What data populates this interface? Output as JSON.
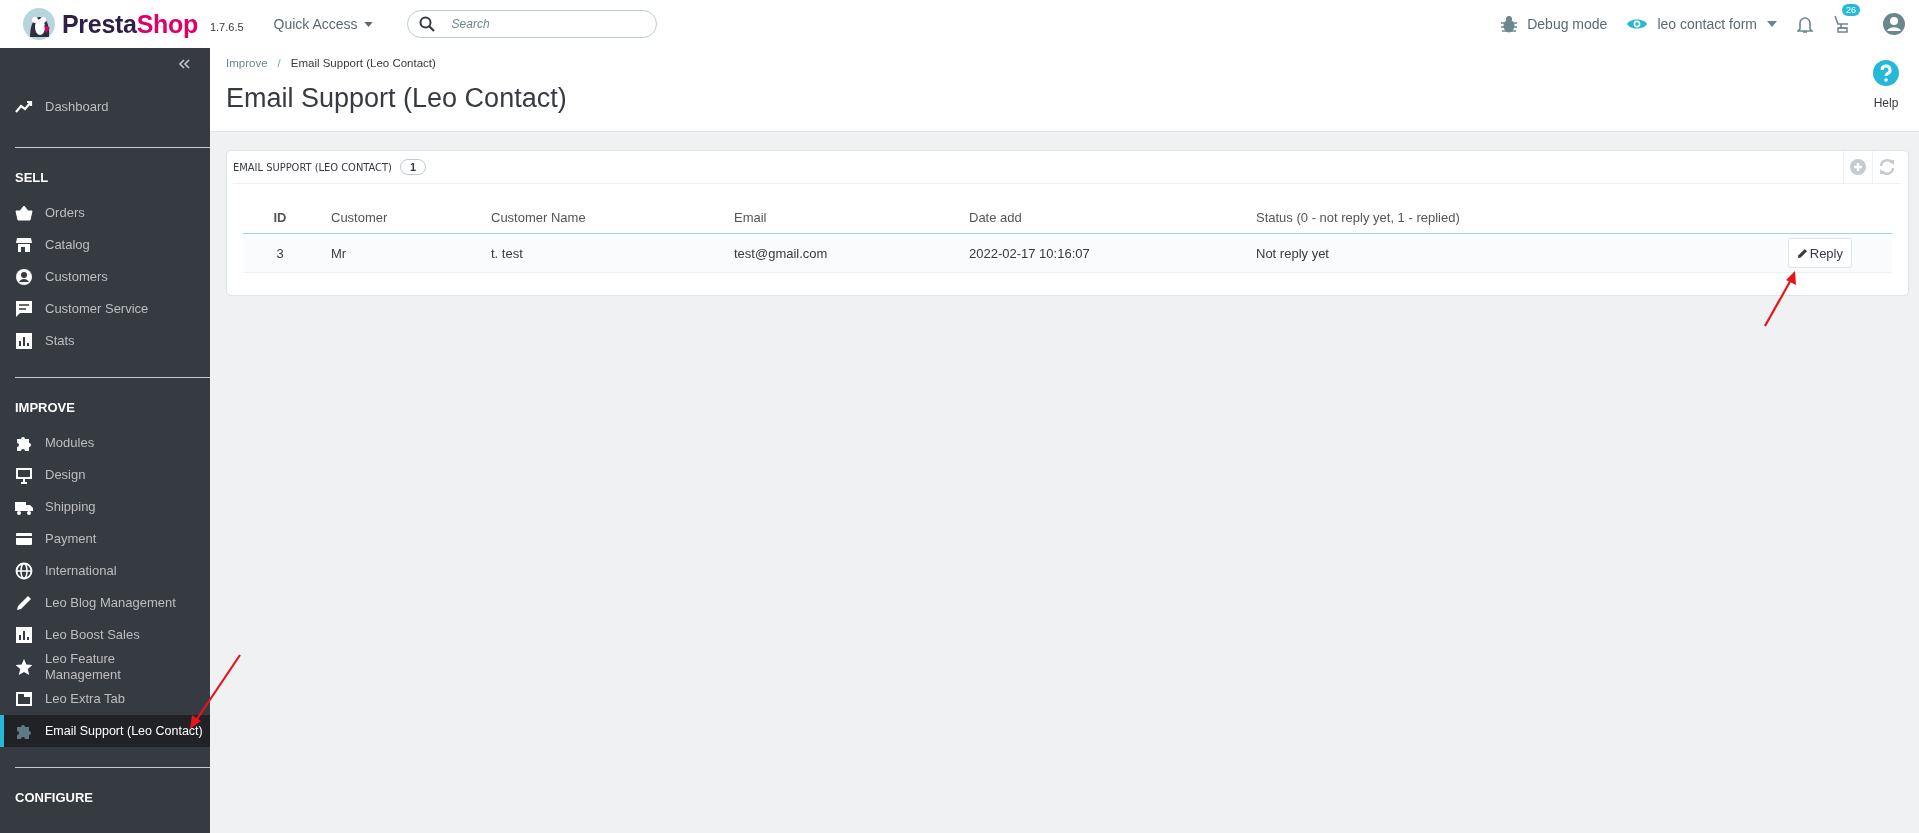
{
  "topbar": {
    "logo": [
      "Presta",
      "Shop"
    ],
    "version": "1.7.6.5",
    "quick_access": "Quick Access",
    "search": {
      "placeholder": "Search"
    },
    "debug": "Debug mode",
    "shop": "leo contact form",
    "orders_badge": "26"
  },
  "sidebar": {
    "sections": [
      {
        "items": [
          {
            "label": "Dashboard",
            "selected": false
          }
        ]
      },
      {
        "heading": "SELL",
        "items": [
          {
            "label": "Orders",
            "selected": false
          },
          {
            "label": "Catalog",
            "selected": false
          },
          {
            "label": "Customers",
            "selected": false
          },
          {
            "label": "Customer Service",
            "selected": false
          },
          {
            "label": "Stats",
            "selected": false
          }
        ]
      },
      {
        "heading": "IMPROVE",
        "items": [
          {
            "label": "Modules",
            "selected": false
          },
          {
            "label": "Design",
            "selected": false
          },
          {
            "label": "Shipping",
            "selected": false
          },
          {
            "label": "Payment",
            "selected": false
          },
          {
            "label": "International",
            "selected": false
          },
          {
            "label": "Leo Blog Management",
            "selected": false
          },
          {
            "label": "Leo Boost Sales",
            "selected": false
          },
          {
            "label": "Leo Feature Management",
            "selected": false
          },
          {
            "label": "Leo Extra Tab",
            "selected": false
          },
          {
            "label": "Email Support (Leo Contact)",
            "selected": true
          }
        ]
      },
      {
        "heading": "CONFIGURE"
      }
    ]
  },
  "breadcrumb": [
    "Improve",
    "Email Support (Leo Contact)"
  ],
  "breadcrumb_separator": "/",
  "page_title": "Email Support (Leo Contact)",
  "help": "Help",
  "panel": {
    "title": "EMAIL SUPPORT (LEO CONTACT)",
    "count": "1",
    "table": {
      "columns": [
        "ID",
        "Customer",
        "Customer Name",
        "Email",
        "Date add",
        "Status (0 - not reply yet, 1 - replied)"
      ],
      "rows": [
        {
          "cells": [
            "3",
            "Mr",
            "t. test",
            "test@gmail.com",
            "2022-02-17 10:16:07",
            "Not reply yet"
          ],
          "action": "Reply"
        }
      ]
    }
  }
}
